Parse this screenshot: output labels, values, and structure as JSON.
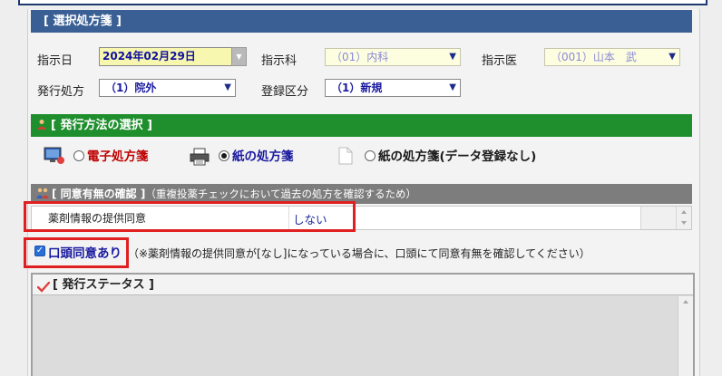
{
  "sections": {
    "selected_prescription": "[ 選択処方箋 ]",
    "issue_method": "[ 発行方法の選択 ]",
    "consent_title": "[ 同意有無の確認 ]",
    "consent_sub": "（重複投薬チェックにおいて過去の処方を確認するため）",
    "status_title": "[ 発行ステータス ]"
  },
  "form": {
    "date_label": "指示日",
    "date_value": "2024年02月29日",
    "dept_label": "指示科",
    "dept_value": "（01）内科",
    "doctor_label": "指示医",
    "doctor_value": "（001）山本　武",
    "issue_label": "発行処方",
    "issue_value": "（1）院外",
    "reg_label": "登録区分",
    "reg_value": "（1）新規"
  },
  "issue_options": [
    {
      "label": "電子処方箋",
      "selected": false,
      "color": "#c00000"
    },
    {
      "label": "紙の処方箋",
      "selected": true,
      "color": "#1a1aa0"
    },
    {
      "label": "紙の処方箋(データ登録なし)",
      "selected": false,
      "color": "#1a1a1a"
    }
  ],
  "consent_table": {
    "item": "薬剤情報の提供同意",
    "value": "しない"
  },
  "verbal_consent": {
    "label": "口頭同意あり",
    "checked": true,
    "note": "（※薬剤情報の提供同意が[なし]になっている場合に、口頭にて同意有無を確認してください）"
  },
  "colors": {
    "header_blue": "#3a5f94",
    "header_green": "#1f8f2e",
    "header_gray": "#7d7d7d",
    "highlight_red": "#e02020"
  }
}
